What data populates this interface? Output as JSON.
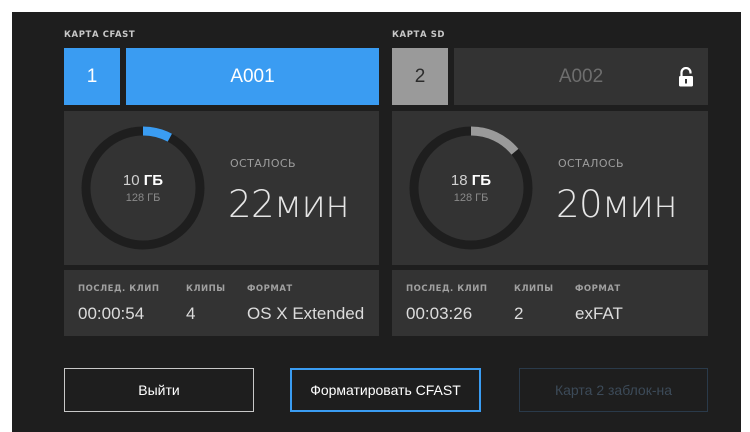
{
  "cards": [
    {
      "title": "КАРТА CFAST",
      "slot": "1",
      "clip_name": "A001",
      "used": "10",
      "used_unit": "ГБ",
      "total": "128 ГБ",
      "remaining_label": "ОСТАЛОСЬ",
      "remaining": "22мин",
      "fill_fraction": 0.078,
      "ring_color": "#3a9cf2",
      "locked": false,
      "last_clip_label": "ПОСЛЕД. КЛИП",
      "last_clip": "00:00:54",
      "clips_label": "КЛИПЫ",
      "clips": "4",
      "format_label": "ФОРМАТ",
      "format": "OS X Extended"
    },
    {
      "title": "КАРТА SD",
      "slot": "2",
      "clip_name": "A002",
      "used": "18",
      "used_unit": "ГБ",
      "total": "128 ГБ",
      "remaining_label": "ОСТАЛОСЬ",
      "remaining": "20мин",
      "fill_fraction": 0.14,
      "ring_color": "#9a9a9a",
      "locked": true,
      "lock_icon": "padlock-icon",
      "last_clip_label": "ПОСЛЕД. КЛИП",
      "last_clip": "00:03:26",
      "clips_label": "КЛИПЫ",
      "clips": "2",
      "format_label": "ФОРМАТ",
      "format": "exFAT"
    }
  ],
  "buttons": {
    "exit": "Выйти",
    "format": "Форматировать CFAST",
    "locked": "Карта 2 заблок-на"
  },
  "colors": {
    "accent": "#3a9cf2",
    "background": "#1e1e1e",
    "panel": "#333333"
  }
}
